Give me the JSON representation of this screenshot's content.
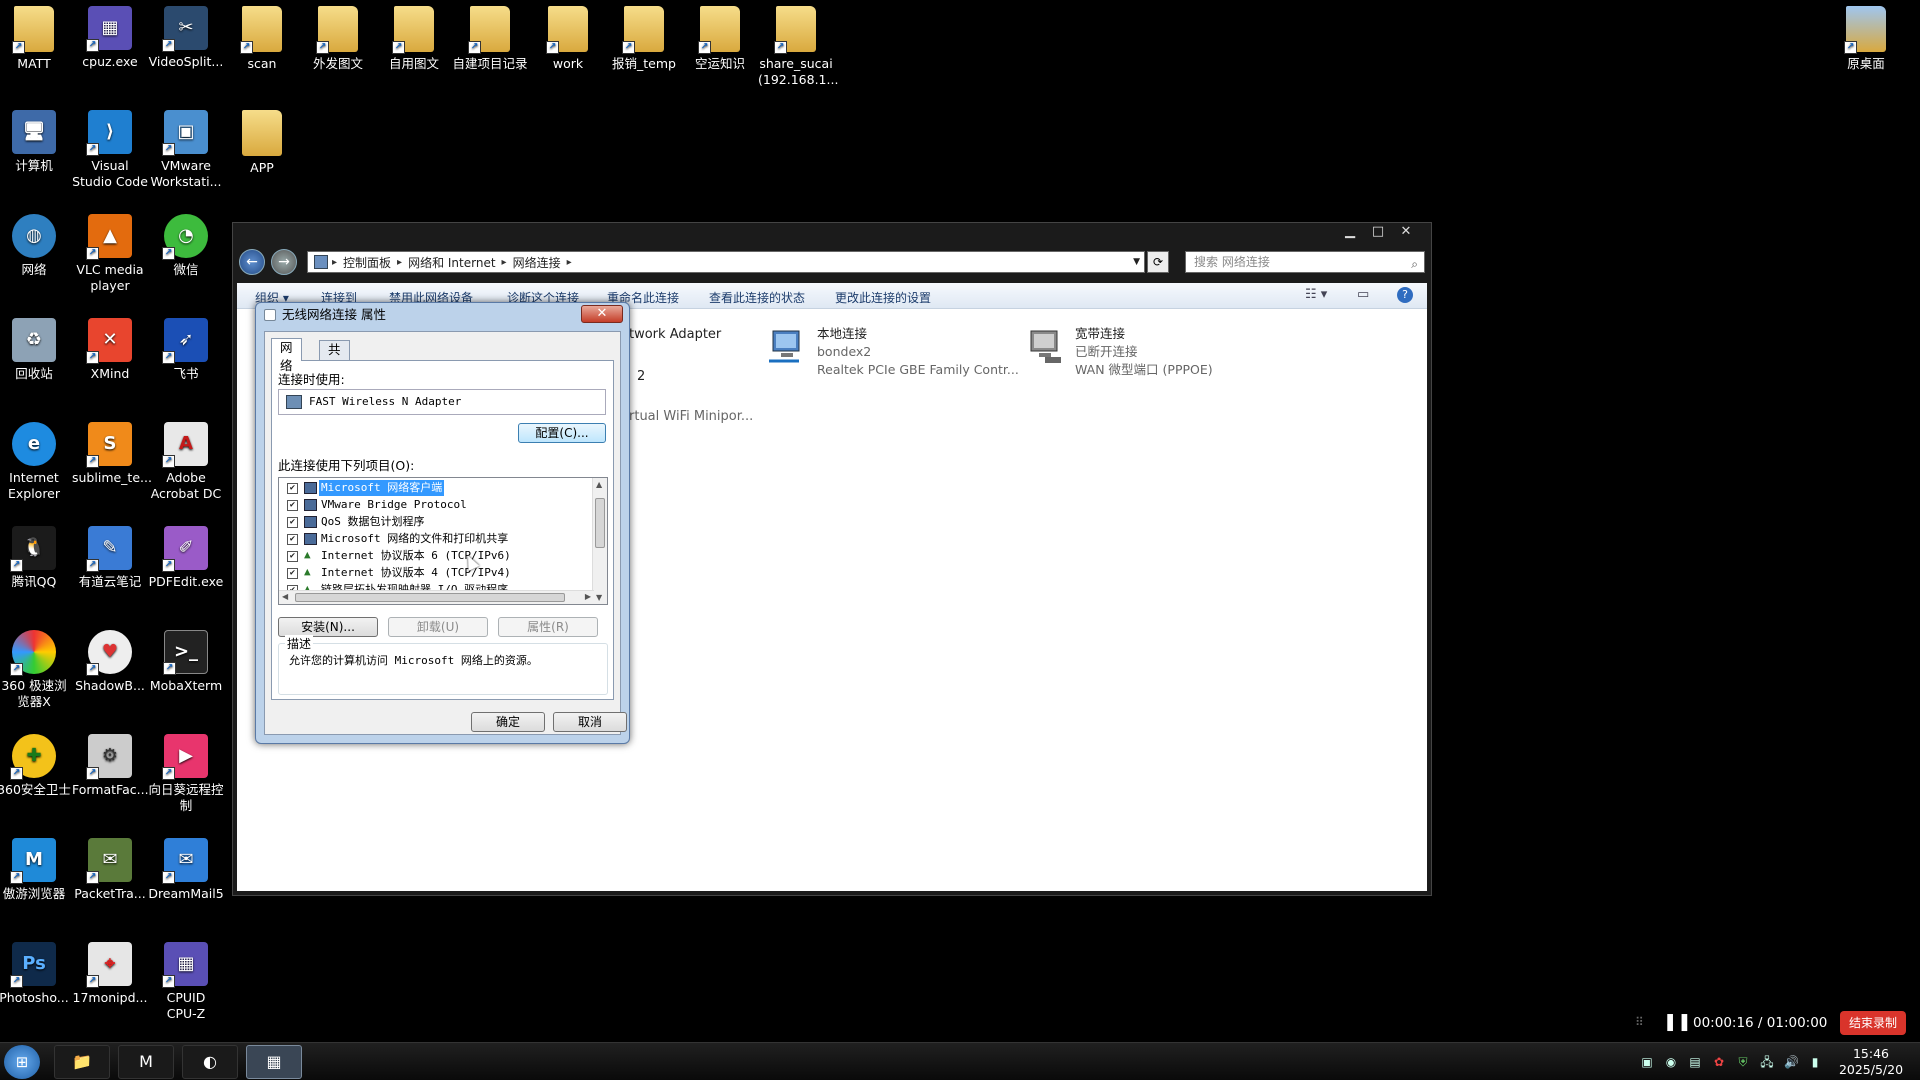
{
  "desktop": {
    "icons": [
      {
        "label": "MATT",
        "icon": "folder-icon"
      },
      {
        "label": "cpuz.exe",
        "icon": "cpuz-icon"
      },
      {
        "label": "VideoSplit...",
        "icon": "video-split-icon"
      },
      {
        "label": "scan",
        "icon": "folder-icon"
      },
      {
        "label": "外发图文",
        "icon": "folder-icon"
      },
      {
        "label": "自用图文",
        "icon": "folder-icon"
      },
      {
        "label": "自建项目记录",
        "icon": "folder-icon"
      },
      {
        "label": "work",
        "icon": "folder-icon"
      },
      {
        "label": "报销_temp",
        "icon": "folder-icon"
      },
      {
        "label": "空运知识",
        "icon": "folder-icon"
      },
      {
        "label": "share_sucai\n(192.168.1...",
        "icon": "folder-icon"
      },
      {
        "label": "原桌面",
        "icon": "folder-icon"
      },
      {
        "label": "计算机",
        "icon": "computer-icon"
      },
      {
        "label": "Visual\nStudio Code",
        "icon": "vscode-icon"
      },
      {
        "label": "VMware\nWorkstati...",
        "icon": "vmware-icon"
      },
      {
        "label": "APP",
        "icon": "folder-icon"
      },
      {
        "label": "网络",
        "icon": "network-icon"
      },
      {
        "label": "VLC media\nplayer",
        "icon": "vlc-icon"
      },
      {
        "label": "微信",
        "icon": "wechat-icon"
      },
      {
        "label": "回收站",
        "icon": "recycle-bin-icon"
      },
      {
        "label": "XMind",
        "icon": "xmind-icon"
      },
      {
        "label": "飞书",
        "icon": "feishu-icon"
      },
      {
        "label": "Internet\nExplorer",
        "icon": "ie-icon"
      },
      {
        "label": "sublime_te...",
        "icon": "sublime-icon"
      },
      {
        "label": "Adobe\nAcrobat DC",
        "icon": "acrobat-icon"
      },
      {
        "label": "腾讯QQ",
        "icon": "qq-icon"
      },
      {
        "label": "有道云笔记",
        "icon": "youdao-icon"
      },
      {
        "label": "PDFEdit.exe",
        "icon": "pdfedit-icon"
      },
      {
        "label": "360 极速浏\n览器X",
        "icon": "360-browser-icon"
      },
      {
        "label": "ShadowB...",
        "icon": "shadowbot-icon"
      },
      {
        "label": "MobaXterm",
        "icon": "mobaxterm-icon"
      },
      {
        "label": "360安全卫士",
        "icon": "360-safe-icon"
      },
      {
        "label": "FormatFac...",
        "icon": "formatfactory-icon"
      },
      {
        "label": "向日葵远程控\n制",
        "icon": "sunlogin-icon"
      },
      {
        "label": "傲游浏览器",
        "icon": "maxthon-icon"
      },
      {
        "label": "PacketTra...",
        "icon": "packettracer-icon"
      },
      {
        "label": "DreamMail5",
        "icon": "dreammail-icon"
      },
      {
        "label": "Photosho...",
        "icon": "photoshop-icon"
      },
      {
        "label": "17monipd...",
        "icon": "ipdb-icon"
      },
      {
        "label": "CPUID\nCPU-Z",
        "icon": "cpuz-icon"
      }
    ]
  },
  "explorer": {
    "breadcrumb": [
      "控制面板",
      "网络和 Internet",
      "网络连接"
    ],
    "search_placeholder": "搜索 网络连接",
    "commands": [
      "组织 ▾",
      "连接到",
      "禁用此网络设备",
      "诊断这个连接",
      "重命名此连接",
      "查看此连接的状态",
      "更改此连接的设置"
    ],
    "connections": [
      {
        "name": "本地连接",
        "status": "bondex2",
        "device": "Realtek PCIe GBE Family Contr..."
      },
      {
        "name": "宽带连接",
        "status": "已断开连接",
        "device": "WAN 微型端口 (PPPOE)"
      }
    ],
    "partial_texts": [
      "twork Adapter",
      "2",
      "rtual WiFi Minipor..."
    ]
  },
  "dialog": {
    "title": "无线网络连接 属性",
    "tabs": [
      "网络",
      "共享"
    ],
    "connect_using_label": "连接时使用:",
    "adapter": "FAST Wireless N Adapter",
    "configure_button": "配置(C)...",
    "items_label": "此连接使用下列项目(O):",
    "items": [
      {
        "label": "Microsoft 网络客户端",
        "checked": true,
        "selected": true
      },
      {
        "label": "VMware Bridge Protocol",
        "checked": true
      },
      {
        "label": "QoS 数据包计划程序",
        "checked": true
      },
      {
        "label": "Microsoft 网络的文件和打印机共享",
        "checked": true
      },
      {
        "label": "Internet 协议版本 6 (TCP/IPv6)",
        "checked": true
      },
      {
        "label": "Internet 协议版本 4 (TCP/IPv4)",
        "checked": true
      },
      {
        "label": "链路层拓扑发现映射器 I/O 驱动程序",
        "checked": true
      }
    ],
    "install_button": "安装(N)...",
    "uninstall_button": "卸载(U)",
    "properties_button": "属性(R)",
    "description_label": "描述",
    "description_text": "允许您的计算机访问 Microsoft 网络上的资源。",
    "ok_button": "确定",
    "cancel_button": "取消"
  },
  "recorder": {
    "time": "00:00:16 / 01:00:00",
    "stop_label": "结束录制"
  },
  "taskbar": {
    "time": "15:46",
    "date": "2025/5/20"
  }
}
